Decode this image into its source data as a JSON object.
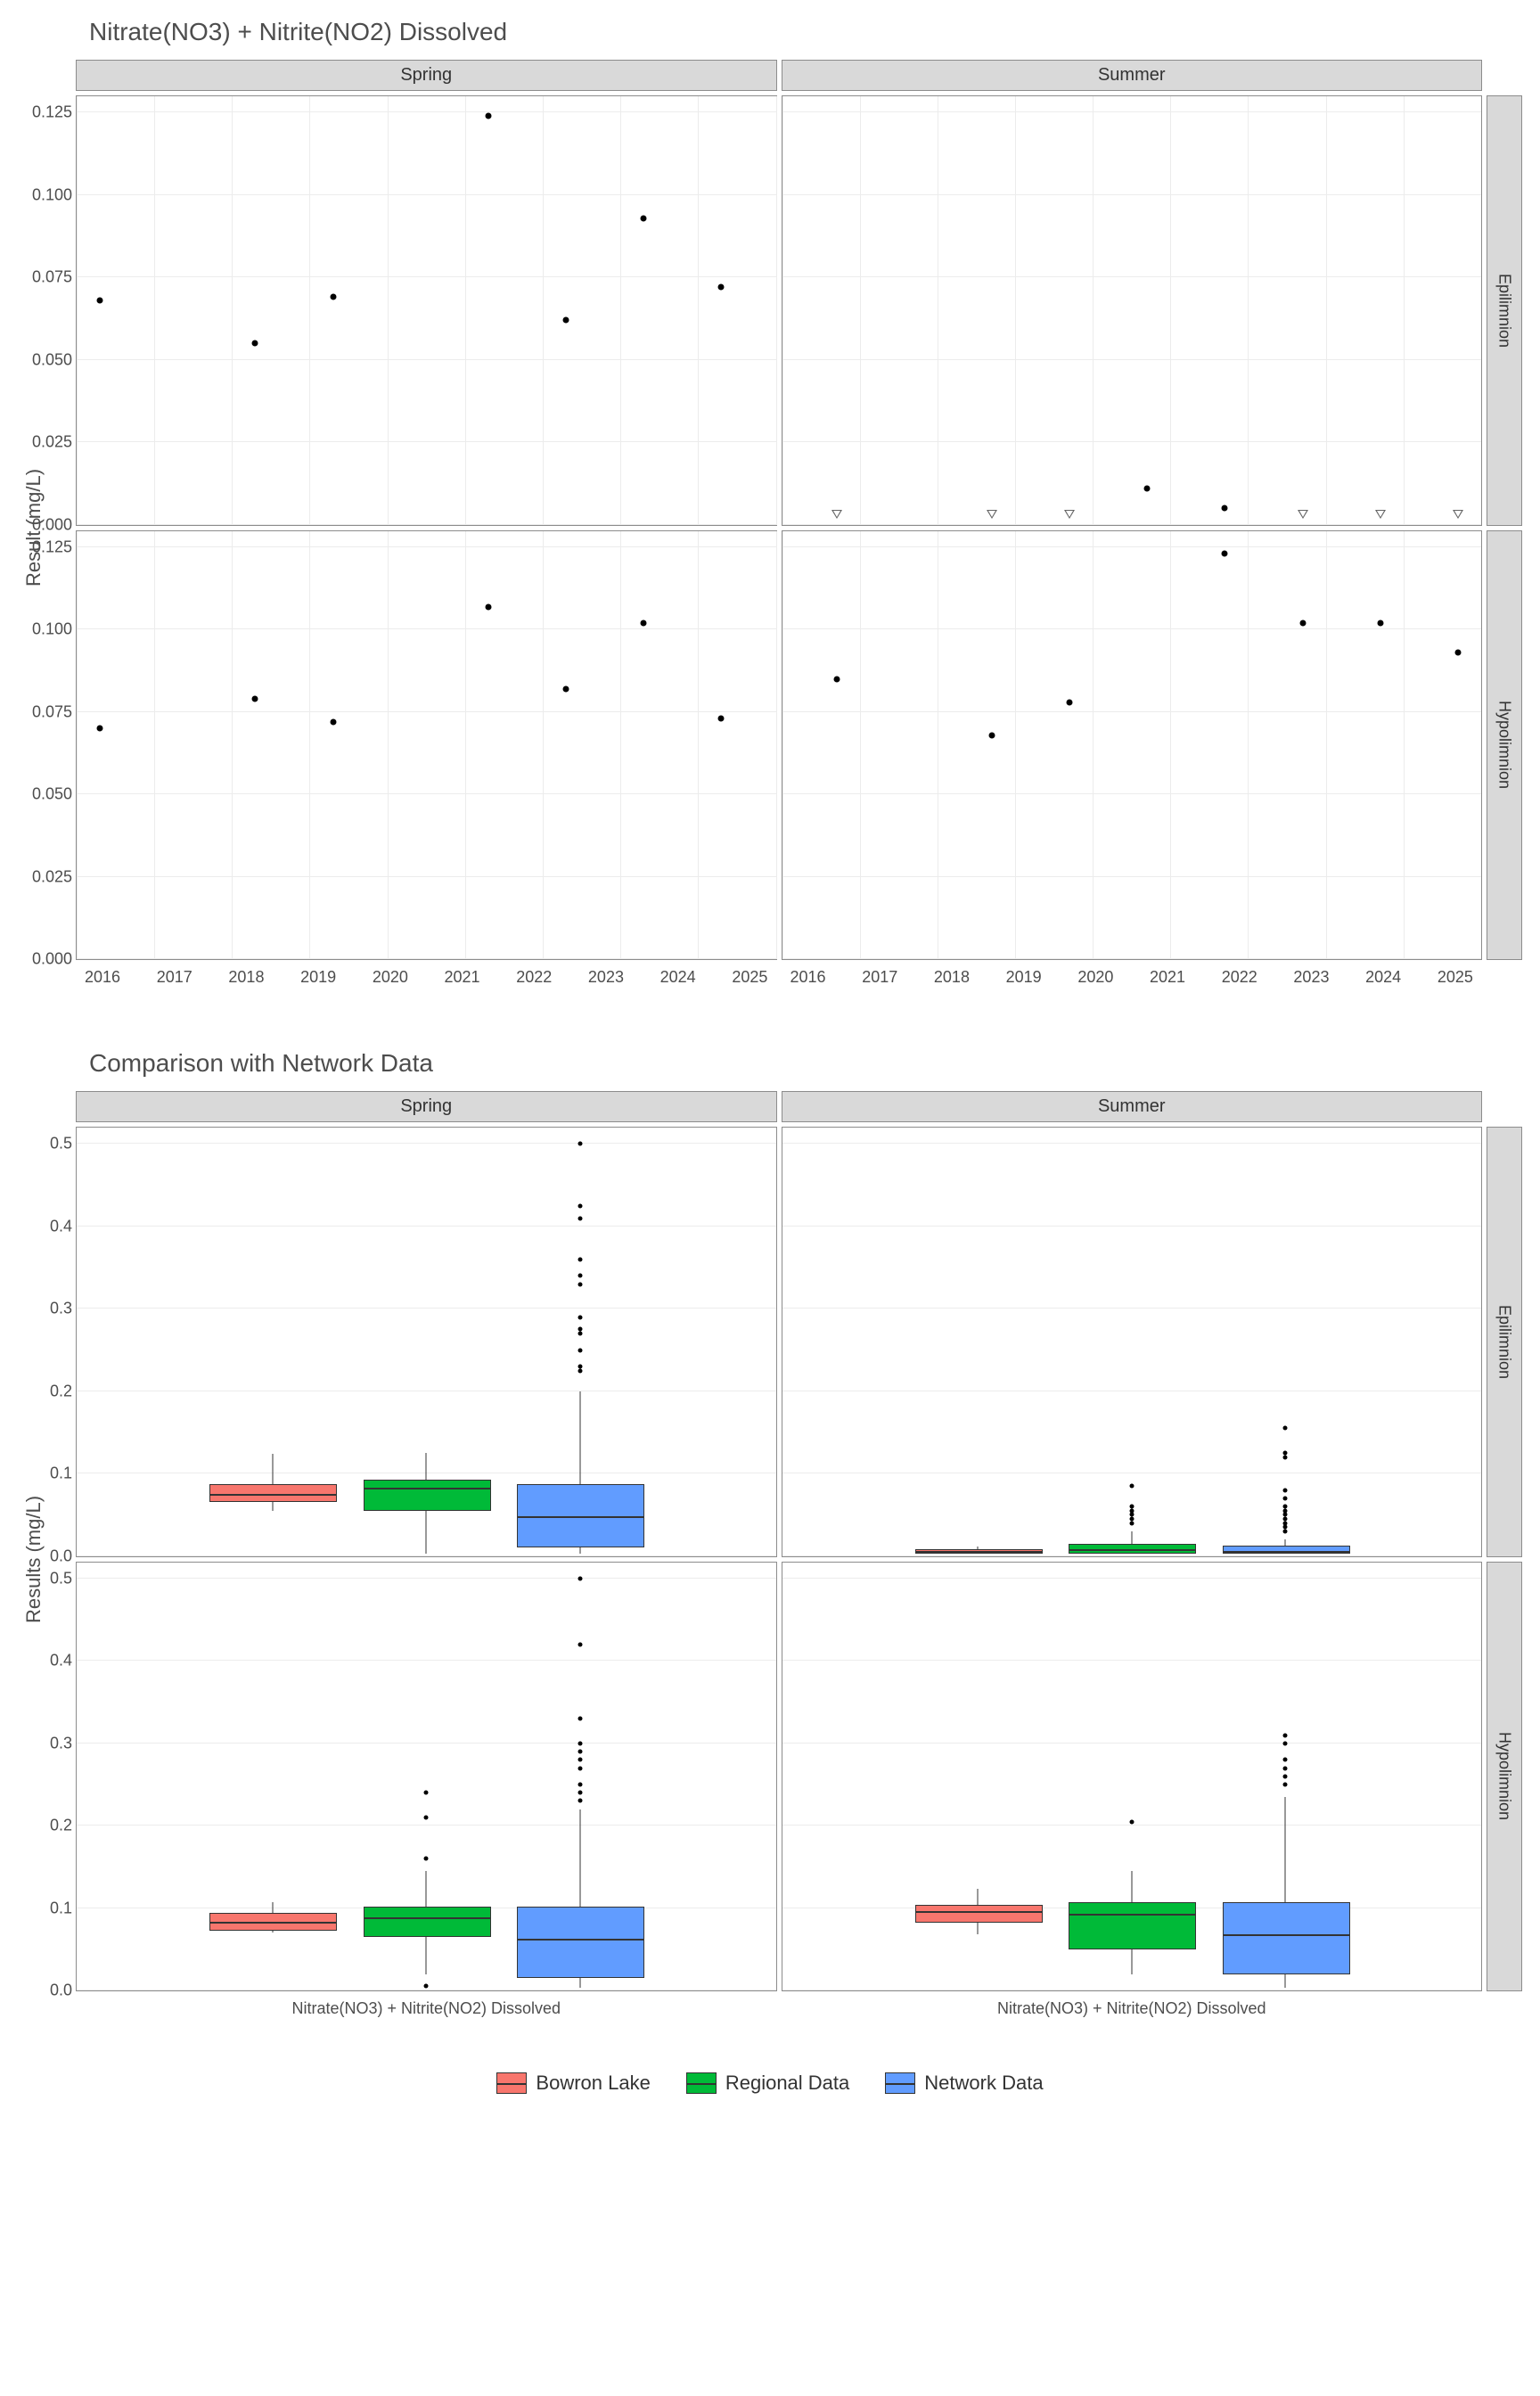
{
  "chart_data": [
    {
      "type": "scatter",
      "title": "Nitrate(NO3) + Nitrite(NO2) Dissolved",
      "ylabel": "Result (mg/L)",
      "xlabel": "",
      "facets_col": [
        "Spring",
        "Summer"
      ],
      "facets_row": [
        "Epilimnion",
        "Hypolimnion"
      ],
      "x_ticks": [
        2016,
        2017,
        2018,
        2019,
        2020,
        2021,
        2022,
        2023,
        2024,
        2025
      ],
      "y_ticks": [
        0.0,
        0.025,
        0.05,
        0.075,
        0.1,
        0.125
      ],
      "ylim": [
        0.0,
        0.13
      ],
      "panels": {
        "Spring_Epilimnion": [
          {
            "x": 2016.3,
            "y": 0.068,
            "bd": false
          },
          {
            "x": 2018.3,
            "y": 0.055,
            "bd": false
          },
          {
            "x": 2019.3,
            "y": 0.069,
            "bd": false
          },
          {
            "x": 2021.3,
            "y": 0.124,
            "bd": false
          },
          {
            "x": 2022.3,
            "y": 0.062,
            "bd": false
          },
          {
            "x": 2023.3,
            "y": 0.093,
            "bd": false
          },
          {
            "x": 2024.3,
            "y": 0.072,
            "bd": false
          }
        ],
        "Summer_Epilimnion": [
          {
            "x": 2016.7,
            "y": 0.003,
            "bd": true
          },
          {
            "x": 2018.7,
            "y": 0.003,
            "bd": true
          },
          {
            "x": 2019.7,
            "y": 0.003,
            "bd": true
          },
          {
            "x": 2020.7,
            "y": 0.011,
            "bd": false
          },
          {
            "x": 2021.7,
            "y": 0.005,
            "bd": false
          },
          {
            "x": 2022.7,
            "y": 0.003,
            "bd": true
          },
          {
            "x": 2023.7,
            "y": 0.003,
            "bd": true
          },
          {
            "x": 2024.7,
            "y": 0.003,
            "bd": true
          }
        ],
        "Spring_Hypolimnion": [
          {
            "x": 2016.3,
            "y": 0.07,
            "bd": false
          },
          {
            "x": 2018.3,
            "y": 0.079,
            "bd": false
          },
          {
            "x": 2019.3,
            "y": 0.072,
            "bd": false
          },
          {
            "x": 2021.3,
            "y": 0.107,
            "bd": false
          },
          {
            "x": 2022.3,
            "y": 0.082,
            "bd": false
          },
          {
            "x": 2023.3,
            "y": 0.102,
            "bd": false
          },
          {
            "x": 2024.3,
            "y": 0.073,
            "bd": false
          }
        ],
        "Summer_Hypolimnion": [
          {
            "x": 2016.7,
            "y": 0.085,
            "bd": false
          },
          {
            "x": 2018.7,
            "y": 0.068,
            "bd": false
          },
          {
            "x": 2019.7,
            "y": 0.078,
            "bd": false
          },
          {
            "x": 2021.7,
            "y": 0.123,
            "bd": false
          },
          {
            "x": 2022.7,
            "y": 0.102,
            "bd": false
          },
          {
            "x": 2023.7,
            "y": 0.102,
            "bd": false
          },
          {
            "x": 2024.7,
            "y": 0.093,
            "bd": false
          }
        ]
      }
    },
    {
      "type": "boxplot",
      "title": "Comparison with Network Data",
      "ylabel": "Results (mg/L)",
      "xlabel": "",
      "facets_col": [
        "Spring",
        "Summer"
      ],
      "facets_row": [
        "Epilimnion",
        "Hypolimnion"
      ],
      "x_category": "Nitrate(NO3) + Nitrite(NO2) Dissolved",
      "y_ticks": [
        0.0,
        0.1,
        0.2,
        0.3,
        0.4,
        0.5
      ],
      "ylim": [
        0.0,
        0.52
      ],
      "legend": [
        "Bowron Lake",
        "Regional Data",
        "Network Data"
      ],
      "panels": {
        "Spring_Epilimnion": {
          "boxes": [
            {
              "series": "Bowron Lake",
              "min": 0.055,
              "q1": 0.065,
              "median": 0.072,
              "q3": 0.085,
              "max": 0.124,
              "outliers": []
            },
            {
              "series": "Regional Data",
              "min": 0.003,
              "q1": 0.055,
              "median": 0.08,
              "q3": 0.09,
              "max": 0.125,
              "outliers": []
            },
            {
              "series": "Network Data",
              "min": 0.003,
              "q1": 0.01,
              "median": 0.045,
              "q3": 0.085,
              "max": 0.2,
              "outliers": [
                0.225,
                0.23,
                0.25,
                0.27,
                0.275,
                0.29,
                0.33,
                0.34,
                0.36,
                0.41,
                0.425,
                0.5
              ]
            }
          ]
        },
        "Summer_Epilimnion": {
          "boxes": [
            {
              "series": "Bowron Lake",
              "min": 0.003,
              "q1": 0.003,
              "median": 0.003,
              "q3": 0.005,
              "max": 0.011,
              "outliers": []
            },
            {
              "series": "Regional Data",
              "min": 0.003,
              "q1": 0.003,
              "median": 0.005,
              "q3": 0.012,
              "max": 0.03,
              "outliers": [
                0.04,
                0.045,
                0.05,
                0.055,
                0.06,
                0.085
              ]
            },
            {
              "series": "Network Data",
              "min": 0.003,
              "q1": 0.003,
              "median": 0.003,
              "q3": 0.01,
              "max": 0.02,
              "outliers": [
                0.03,
                0.035,
                0.04,
                0.045,
                0.05,
                0.055,
                0.06,
                0.07,
                0.08,
                0.12,
                0.125,
                0.155
              ]
            }
          ]
        },
        "Spring_Hypolimnion": {
          "boxes": [
            {
              "series": "Bowron Lake",
              "min": 0.07,
              "q1": 0.073,
              "median": 0.08,
              "q3": 0.092,
              "max": 0.107,
              "outliers": []
            },
            {
              "series": "Regional Data",
              "min": 0.02,
              "q1": 0.065,
              "median": 0.085,
              "q3": 0.1,
              "max": 0.145,
              "outliers": [
                0.005,
                0.16,
                0.21,
                0.24
              ]
            },
            {
              "series": "Network Data",
              "min": 0.003,
              "q1": 0.015,
              "median": 0.06,
              "q3": 0.1,
              "max": 0.22,
              "outliers": [
                0.23,
                0.24,
                0.25,
                0.27,
                0.28,
                0.29,
                0.3,
                0.33,
                0.42,
                0.5
              ]
            }
          ]
        },
        "Summer_Hypolimnion": {
          "boxes": [
            {
              "series": "Bowron Lake",
              "min": 0.068,
              "q1": 0.082,
              "median": 0.093,
              "q3": 0.102,
              "max": 0.123,
              "outliers": []
            },
            {
              "series": "Regional Data",
              "min": 0.02,
              "q1": 0.05,
              "median": 0.09,
              "q3": 0.105,
              "max": 0.145,
              "outliers": [
                0.205
              ]
            },
            {
              "series": "Network Data",
              "min": 0.003,
              "q1": 0.02,
              "median": 0.065,
              "q3": 0.105,
              "max": 0.235,
              "outliers": [
                0.25,
                0.26,
                0.27,
                0.28,
                0.3,
                0.31
              ]
            }
          ]
        }
      }
    }
  ]
}
